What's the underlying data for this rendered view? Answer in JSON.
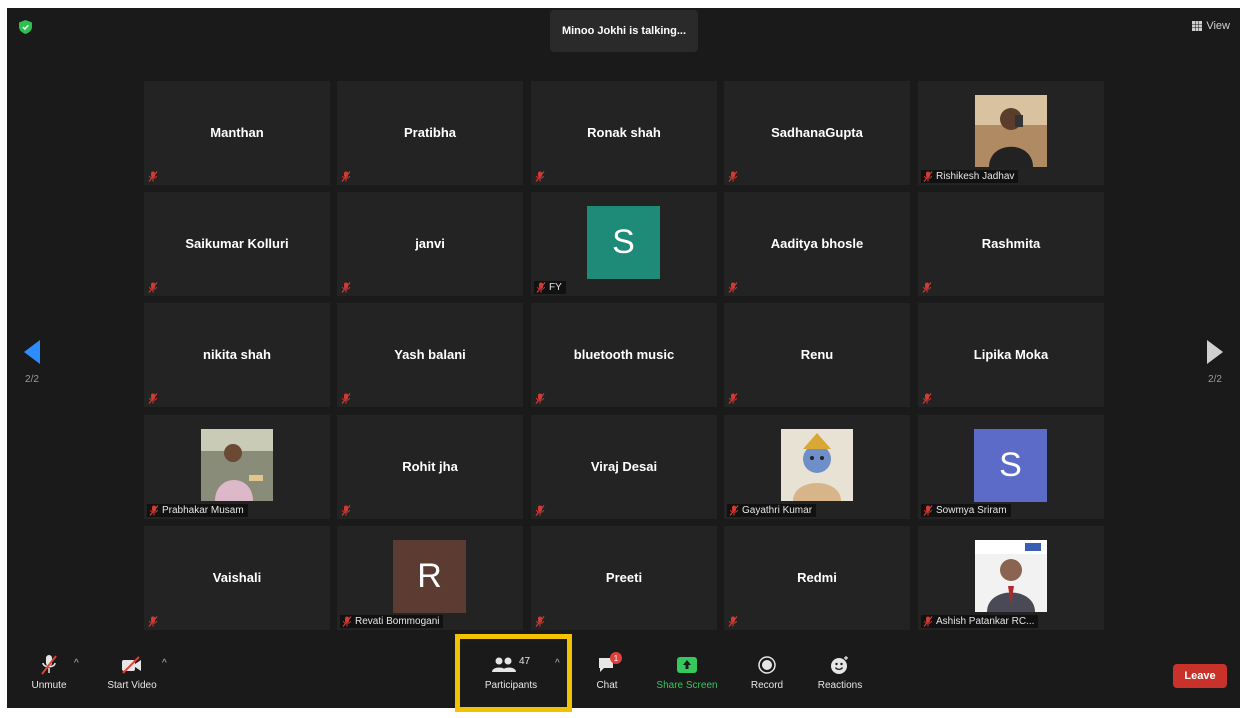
{
  "header": {
    "talking_text": "Minoo Jokhi is talking...",
    "view_label": "View"
  },
  "paging": {
    "left_label": "2/2",
    "right_label": "2/2"
  },
  "participants": [
    {
      "name": "Manthan",
      "type": "name"
    },
    {
      "name": "Pratibha",
      "type": "name"
    },
    {
      "name": "Ronak shah",
      "type": "name"
    },
    {
      "name": "SadhanaGupta",
      "type": "name"
    },
    {
      "name": "Rishikesh Jadhav",
      "type": "photo"
    },
    {
      "name": "Saikumar Kolluri",
      "type": "name"
    },
    {
      "name": "janvi",
      "type": "name"
    },
    {
      "name": "FY",
      "type": "avatar",
      "letter": "S",
      "color": "#1e8a78"
    },
    {
      "name": "Aaditya bhosle",
      "type": "name"
    },
    {
      "name": "Rashmita",
      "type": "name"
    },
    {
      "name": "nikita shah",
      "type": "name"
    },
    {
      "name": "Yash balani",
      "type": "name"
    },
    {
      "name": "bluetooth music",
      "type": "name"
    },
    {
      "name": "Renu",
      "type": "name"
    },
    {
      "name": "Lipika Moka",
      "type": "name"
    },
    {
      "name": "Prabhakar Musam",
      "type": "photo"
    },
    {
      "name": "Rohit jha",
      "type": "name"
    },
    {
      "name": "Viraj Desai",
      "type": "name"
    },
    {
      "name": "Gayathri Kumar",
      "type": "photo"
    },
    {
      "name": "Sowmya Sriram",
      "type": "avatar",
      "letter": "S",
      "color": "#5c6bc8"
    },
    {
      "name": "Vaishali",
      "type": "name"
    },
    {
      "name": "Revati Bommogani",
      "type": "avatar",
      "letter": "R",
      "color": "#5b3b32"
    },
    {
      "name": "Preeti",
      "type": "name"
    },
    {
      "name": "Redmi",
      "type": "name"
    },
    {
      "name": "Ashish Patankar RC...",
      "type": "photo"
    }
  ],
  "toolbar": {
    "unmute": "Unmute",
    "start_video": "Start Video",
    "participants": "Participants",
    "participants_count": "47",
    "chat": "Chat",
    "chat_badge": "1",
    "share_screen": "Share Screen",
    "record": "Record",
    "reactions": "Reactions",
    "leave": "Leave"
  },
  "colors": {
    "background": "#1a1a1a",
    "tile": "#232323",
    "accent_blue": "#2d8cff",
    "share_green": "#35c85c",
    "leave_red": "#c8322a",
    "highlight_yellow": "#f2c200"
  }
}
